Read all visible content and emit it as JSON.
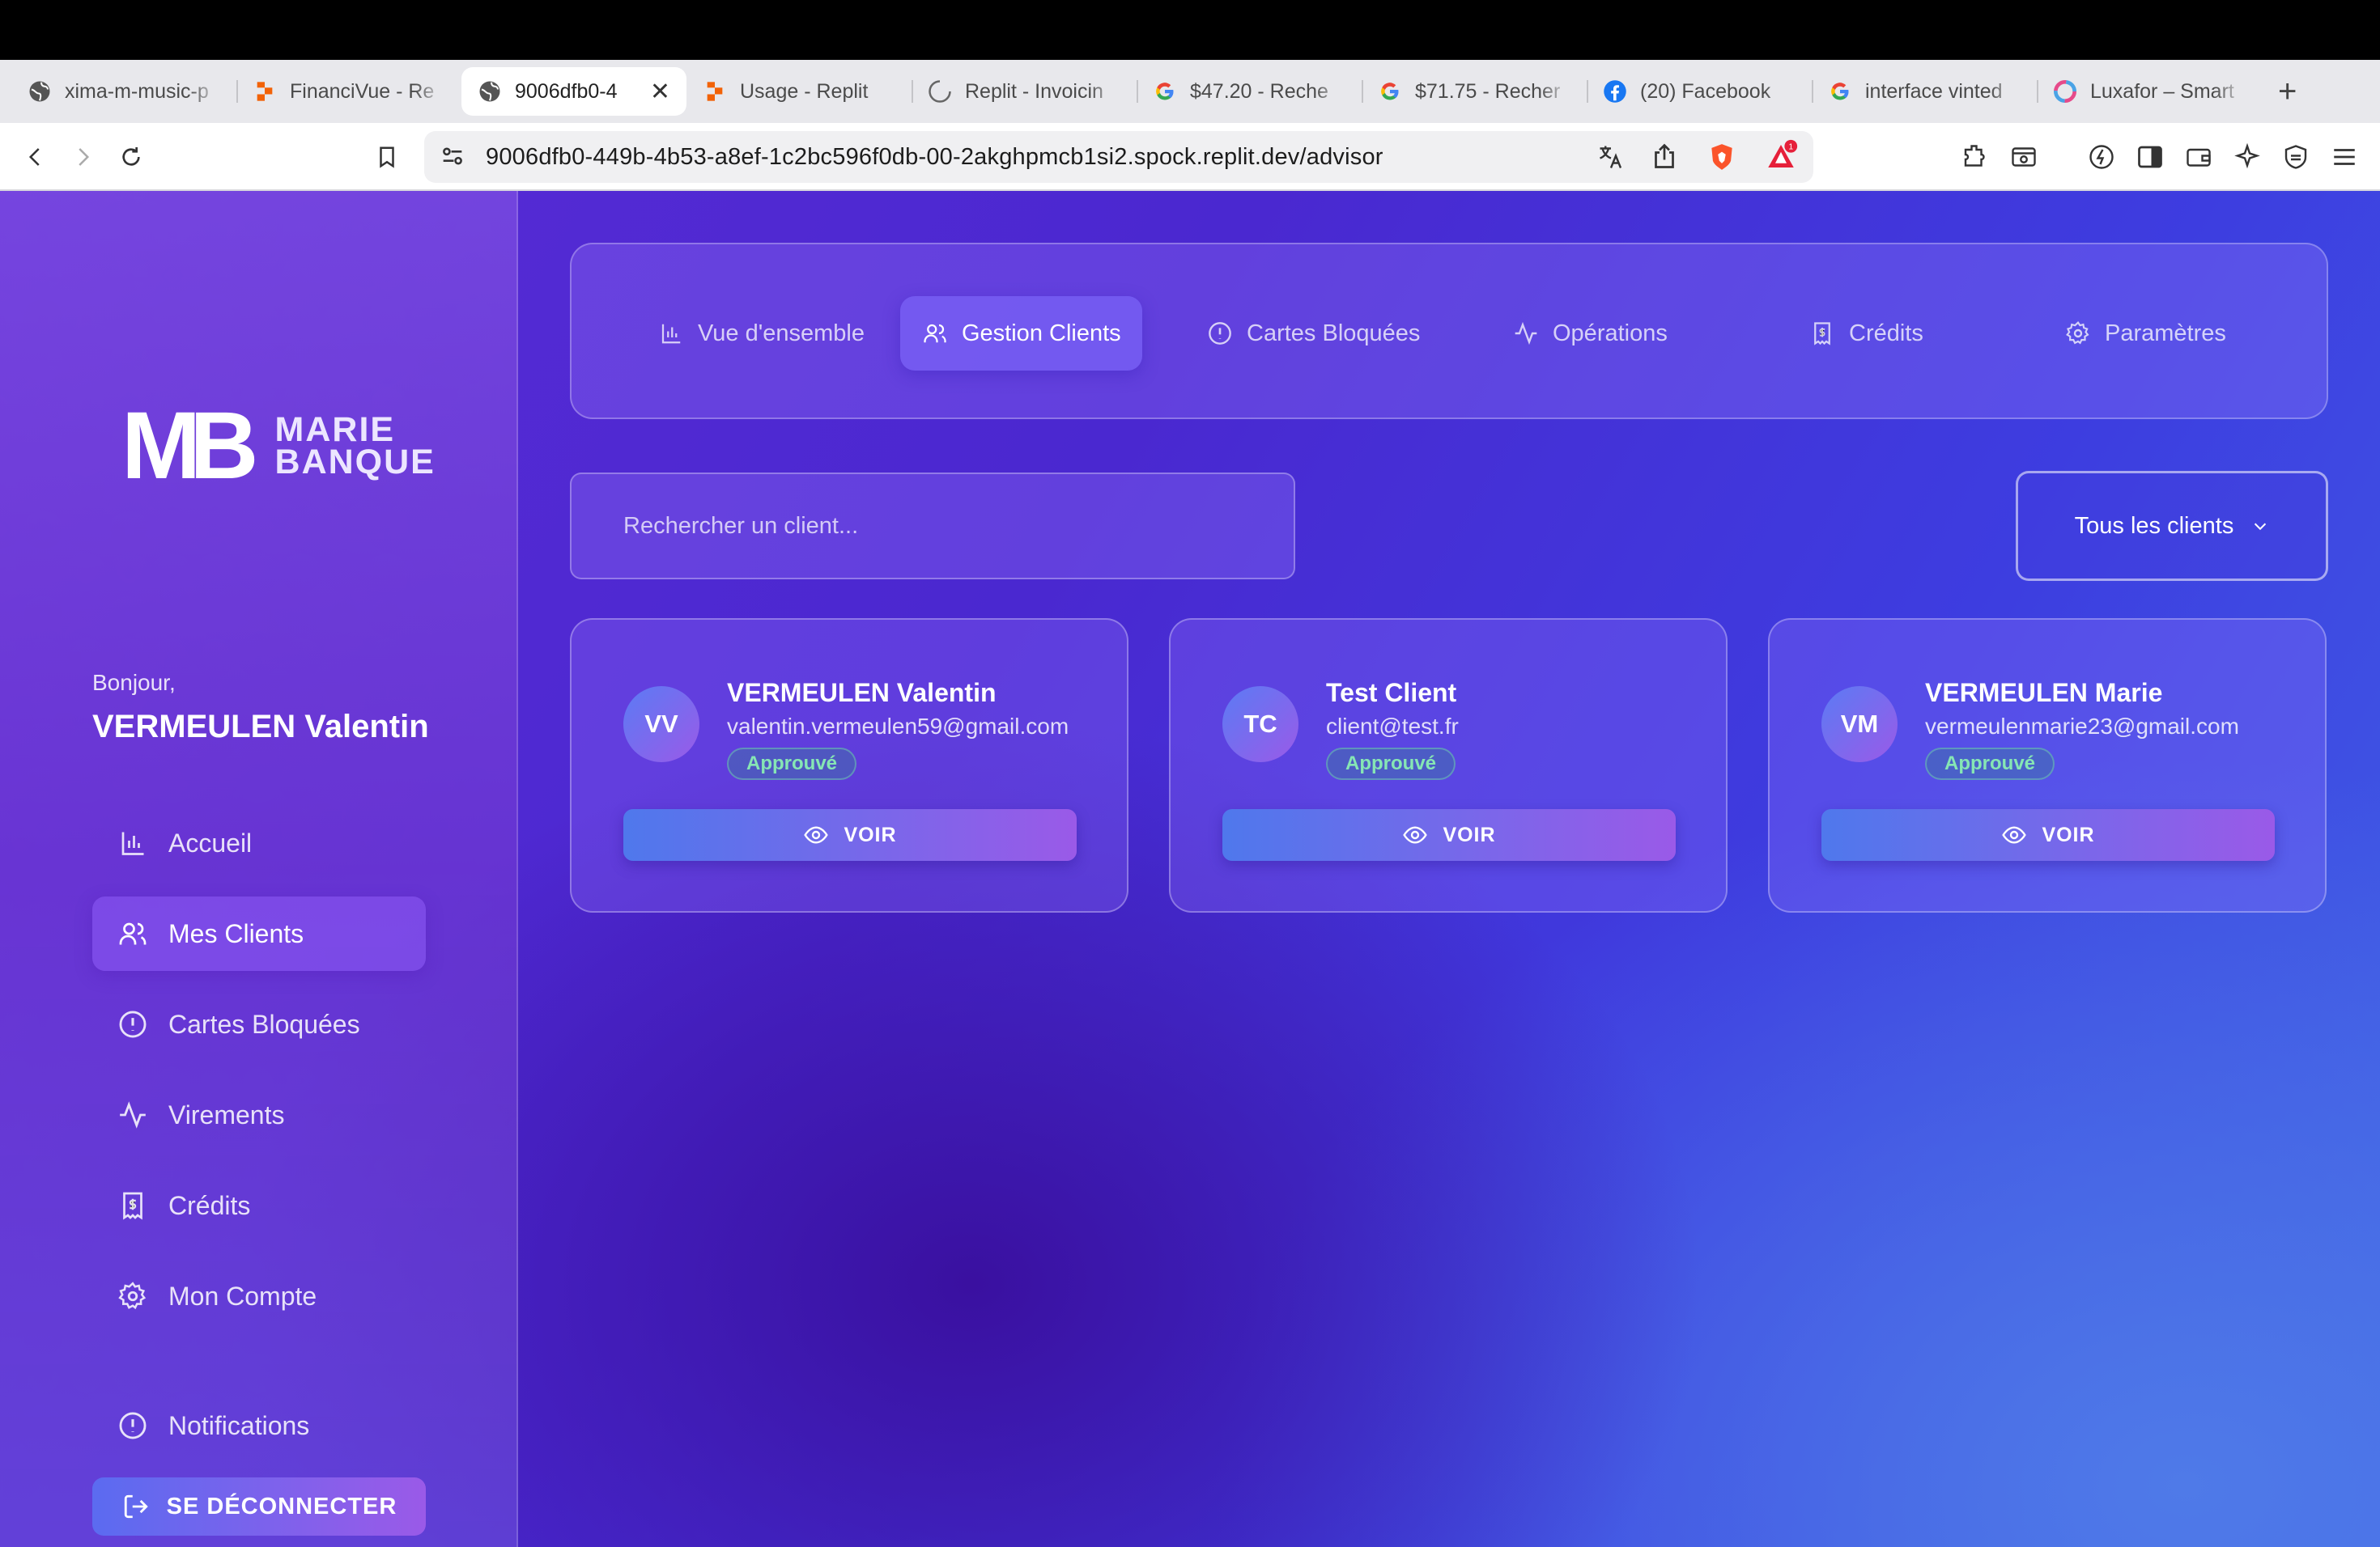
{
  "browser": {
    "tabs": [
      {
        "title": "xima-m-music-p",
        "icon": "globe-icon"
      },
      {
        "title": "FinanciVue - Re",
        "icon": "replit-icon"
      },
      {
        "title": "9006dfb0-4",
        "icon": "globe-icon",
        "active": true
      },
      {
        "title": "Usage - Replit",
        "icon": "replit-icon"
      },
      {
        "title": "Replit - Invoicin",
        "icon": "loading-icon"
      },
      {
        "title": "$47.20 - Reche",
        "icon": "google-icon"
      },
      {
        "title": "$71.75 - Recher",
        "icon": "google-icon"
      },
      {
        "title": "(20) Facebook",
        "icon": "facebook-icon"
      },
      {
        "title": "interface vinted",
        "icon": "google-icon"
      },
      {
        "title": "Luxafor – Smart",
        "icon": "luxafor-icon"
      }
    ],
    "url": "9006dfb0-449b-4b53-a8ef-1c2bc596f0db-00-2akghpmcb1si2.spock.replit.dev/advisor",
    "notification_count": "1"
  },
  "logo": {
    "mark": "MB",
    "line1": "MARIE",
    "line2": "BANQUE"
  },
  "sidebar": {
    "greeting": "Bonjour,",
    "user_name": "VERMEULEN Valentin",
    "items": [
      {
        "label": "Accueil",
        "icon": "bar-chart-icon"
      },
      {
        "label": "Mes Clients",
        "icon": "users-icon",
        "active": true
      },
      {
        "label": "Cartes Bloquées",
        "icon": "alert-circle-icon"
      },
      {
        "label": "Virements",
        "icon": "activity-icon"
      },
      {
        "label": "Crédits",
        "icon": "receipt-icon"
      },
      {
        "label": "Mon Compte",
        "icon": "gear-icon"
      },
      {
        "label": "Notifications",
        "icon": "alert-circle-icon"
      }
    ],
    "logout_label": "SE DÉCONNECTER"
  },
  "top_tabs": [
    {
      "label": "Vue d'ensemble",
      "icon": "bar-chart-icon"
    },
    {
      "label": "Gestion Clients",
      "icon": "users-icon",
      "active": true
    },
    {
      "label": "Cartes Bloquées",
      "icon": "alert-circle-icon"
    },
    {
      "label": "Opérations",
      "icon": "activity-icon"
    },
    {
      "label": "Crédits",
      "icon": "receipt-icon"
    },
    {
      "label": "Paramètres",
      "icon": "gear-icon"
    }
  ],
  "search": {
    "placeholder": "Rechercher un client..."
  },
  "filter": {
    "selected": "Tous les clients"
  },
  "clients": [
    {
      "initials": "VV",
      "name": "VERMEULEN Valentin",
      "email": "valentin.vermeulen59@gmail.com",
      "status": "Approuvé",
      "action": "VOIR"
    },
    {
      "initials": "TC",
      "name": "Test Client",
      "email": "client@test.fr",
      "status": "Approuvé",
      "action": "VOIR"
    },
    {
      "initials": "VM",
      "name": "VERMEULEN Marie",
      "email": "vermeulenmarie23@gmail.com",
      "status": "Approuvé",
      "action": "VOIR"
    }
  ],
  "colors": {
    "accent_start": "#4f78ec",
    "accent_end": "#9a5ae8",
    "status_approved": "#86e6b4"
  }
}
